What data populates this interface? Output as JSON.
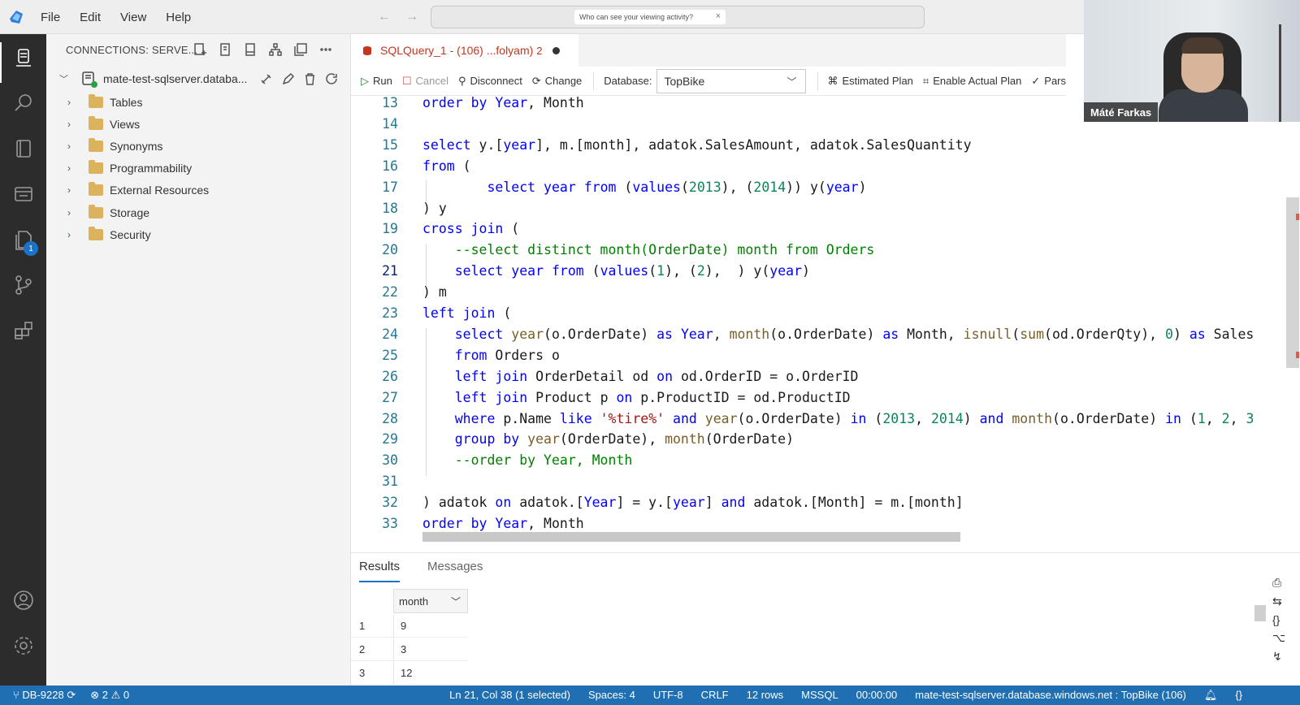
{
  "menu": [
    "File",
    "Edit",
    "View",
    "Help"
  ],
  "command_center": {
    "notice": "Who can see your viewing activity?",
    "close": "×"
  },
  "sidebar": {
    "header": "CONNECTIONS: SERVE...",
    "connection": "mate-test-sqlserver.databa...",
    "nodes": [
      "Tables",
      "Views",
      "Synonyms",
      "Programmability",
      "External Resources",
      "Storage",
      "Security"
    ]
  },
  "activity": {
    "badge": "1"
  },
  "editor_tab": {
    "label": "SQLQuery_1 - (106) ...folyam)",
    "count": "2"
  },
  "toolbar": {
    "run": "Run",
    "cancel": "Cancel",
    "disconnect": "Disconnect",
    "change": "Change",
    "database_label": "Database:",
    "database_value": "TopBike",
    "estimated_plan": "Estimated Plan",
    "enable_actual_plan": "Enable Actual Plan",
    "parse": "Pars"
  },
  "code_lines": [
    {
      "n": "13",
      "text": "order by Year, Month"
    },
    {
      "n": "14",
      "text": ""
    },
    {
      "n": "15",
      "text": "select y.[year], m.[month], adatok.SalesAmount, adatok.SalesQuantity"
    },
    {
      "n": "16",
      "text": "from ("
    },
    {
      "n": "17",
      "text": "        select year from (values(2013), (2014)) y(year)"
    },
    {
      "n": "18",
      "text": ") y"
    },
    {
      "n": "19",
      "text": "cross join ("
    },
    {
      "n": "20",
      "text": "    --select distinct month(OrderDate) month from Orders"
    },
    {
      "n": "21",
      "text": "    select year from (values(1), (2),  ) y(year)"
    },
    {
      "n": "22",
      "text": ") m"
    },
    {
      "n": "23",
      "text": "left join ("
    },
    {
      "n": "24",
      "text": "    select year(o.OrderDate) as Year, month(o.OrderDate) as Month, isnull(sum(od.OrderQty), 0) as Sales"
    },
    {
      "n": "25",
      "text": "    from Orders o"
    },
    {
      "n": "26",
      "text": "    left join OrderDetail od on od.OrderID = o.OrderID"
    },
    {
      "n": "27",
      "text": "    left join Product p on p.ProductID = od.ProductID"
    },
    {
      "n": "28",
      "text": "    where p.Name like '%tire%' and year(o.OrderDate) in (2013, 2014) and month(o.OrderDate) in (1, 2, 3"
    },
    {
      "n": "29",
      "text": "    group by year(OrderDate), month(OrderDate)"
    },
    {
      "n": "30",
      "text": "    --order by Year, Month"
    },
    {
      "n": "31",
      "text": ""
    },
    {
      "n": "32",
      "text": ") adatok on adatok.[Year] = y.[year] and adatok.[Month] = m.[month]"
    },
    {
      "n": "33",
      "text": "order by Year, Month"
    }
  ],
  "results": {
    "tabs": [
      "Results",
      "Messages"
    ],
    "column": "month",
    "rows": [
      {
        "n": "1",
        "v": "9"
      },
      {
        "n": "2",
        "v": "3"
      },
      {
        "n": "3",
        "v": "12"
      }
    ]
  },
  "statusbar": {
    "branch": "DB-9228",
    "errors": "2",
    "warnings": "0",
    "position": "Ln 21, Col 38 (1 selected)",
    "spaces": "Spaces: 4",
    "encoding": "UTF-8",
    "eol": "CRLF",
    "rows": "12 rows",
    "language": "MSSQL",
    "time": "00:00:00",
    "connection": "mate-test-sqlserver.database.windows.net : TopBike (106)"
  },
  "webcam": {
    "name": "Máté Farkas"
  },
  "colors": {
    "statusbar": "#1f6fb2",
    "activity_bar": "#2c2c2c",
    "keyword": "#0000ff",
    "accent": "#1a73c9"
  }
}
